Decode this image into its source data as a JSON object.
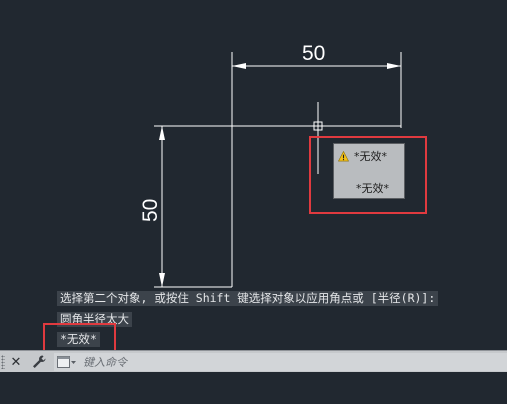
{
  "drawing": {
    "horizontal_dimension": "50",
    "vertical_dimension": "50"
  },
  "tooltip": {
    "row1_value": "*无效*",
    "row2_value": "*无效*"
  },
  "command_history": {
    "line1": "选择第二个对象, 或按住 Shift 键选择对象以应用角点或 [半径(R)]:",
    "line2": "圆角半径太大",
    "line3": "*无效*"
  },
  "command_bar": {
    "close_glyph": "✕",
    "input_placeholder": "键入命令"
  },
  "colors": {
    "background": "#212830",
    "highlight": "#e03a3f",
    "line": "#ffffff"
  }
}
